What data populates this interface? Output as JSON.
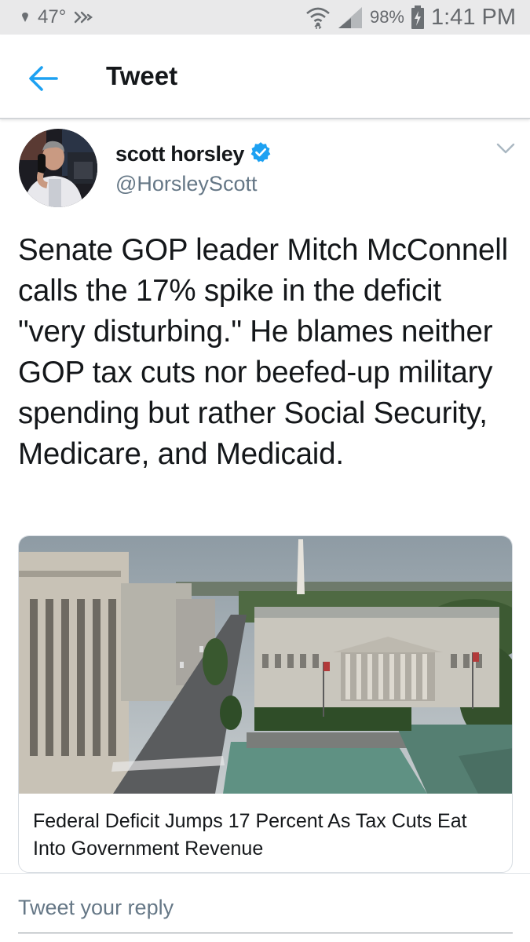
{
  "status_bar": {
    "temperature": "47°",
    "battery_percent": "98%",
    "time": "1:41 PM",
    "icons": [
      "location-dot-icon",
      "weather-icon",
      "wifi-icon",
      "cell-signal-icon",
      "battery-charging-icon"
    ]
  },
  "header": {
    "back_icon": "arrow-left-icon",
    "title": "Tweet",
    "accent_color": "#1da1f2"
  },
  "tweet": {
    "author_name": "scott horsley",
    "handle": "@HorsleyScott",
    "verified": true,
    "text": "Senate GOP leader Mitch McConnell calls the 17% spike in the deficit \"very disturbing.\"  He blames neither GOP tax cuts nor beefed-up military spending but rather Social Security, Medicare, and Medicaid.",
    "menu_icon": "chevron-down-icon"
  },
  "card": {
    "image_alt": "Aerial view of U.S. Treasury building and Washington Monument",
    "title": "Federal Deficit Jumps 17 Percent As Tax Cuts Eat Into Government Revenue"
  },
  "reply": {
    "placeholder": "Tweet your reply"
  }
}
